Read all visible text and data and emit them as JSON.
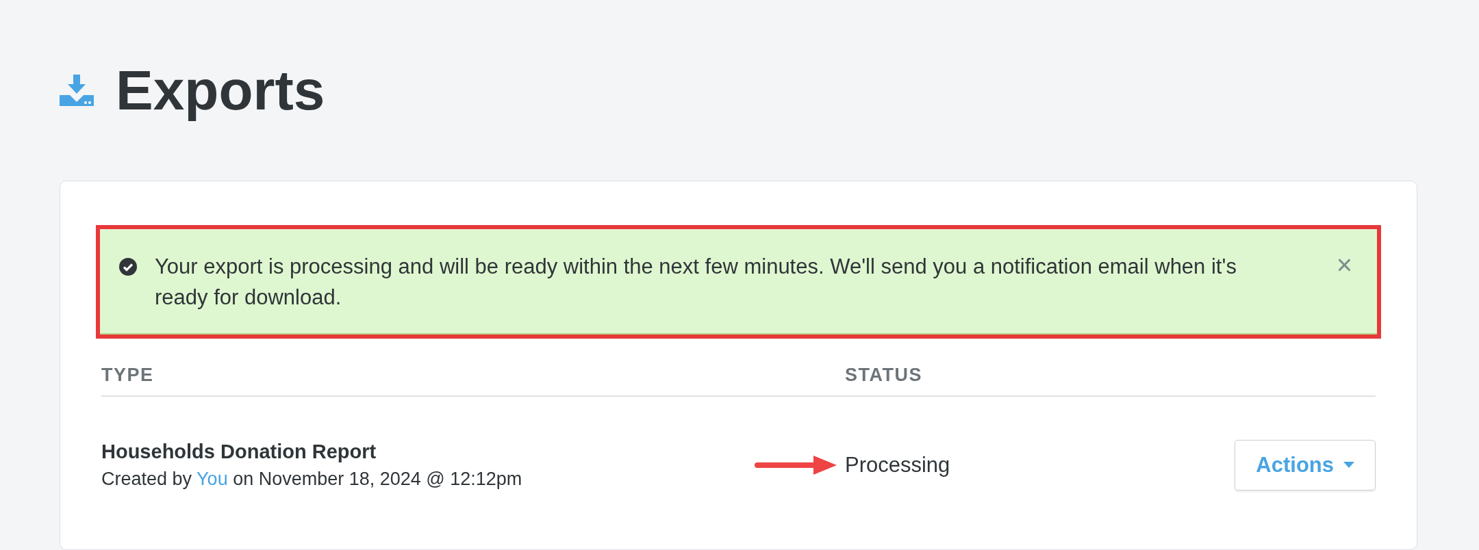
{
  "page": {
    "title": "Exports"
  },
  "alert": {
    "message": "Your export is processing and will be ready within the next few minutes. We'll send you a notification email when it's ready for download.",
    "close": "×",
    "highlighted": true
  },
  "table": {
    "columns": [
      "TYPE",
      "STATUS"
    ],
    "rows": [
      {
        "type": "Households Donation Report",
        "created_prefix": "Created by",
        "creator": "You",
        "created_suffix": "on November 18, 2024 @ 12:12pm",
        "status": "Processing",
        "status_arrow": true,
        "action": "Actions"
      }
    ]
  }
}
